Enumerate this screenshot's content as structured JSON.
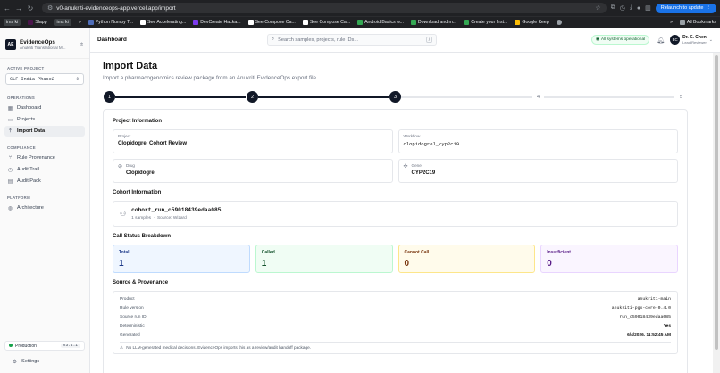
{
  "browser": {
    "url": "v0-anukriti-evidenceops-app.vercel.app/import",
    "relaunch_label": "Relaunch to update",
    "bookmarks": [
      "ims ki",
      "Slapp",
      "ims ki",
      "Python Numpy T...",
      "See Accelerating...",
      "DevCreate Hacka...",
      "See Compose Ca...",
      "See Compose Ca...",
      "Android Basics w...",
      "Download and m...",
      "Create your first...",
      "Google Keep"
    ],
    "all_bookmarks_label": "All Bookmarks"
  },
  "sidebar": {
    "brand_logo": "AE",
    "brand_name": "EvidenceOps",
    "brand_sub": "Anukriti Translational M...",
    "active_project_heading": "ACTIVE PROJECT",
    "active_project": "CLF-India-Phase2",
    "operations_heading": "OPERATIONS",
    "operations": [
      {
        "label": "Dashboard",
        "icon": "grid-icon"
      },
      {
        "label": "Projects",
        "icon": "folder-icon"
      },
      {
        "label": "Import Data",
        "icon": "upload-icon"
      }
    ],
    "compliance_heading": "COMPLIANCE",
    "compliance": [
      {
        "label": "Rule Provenance",
        "icon": "branch-icon"
      },
      {
        "label": "Audit Trail",
        "icon": "clock-icon"
      },
      {
        "label": "Audit Pack",
        "icon": "document-icon"
      }
    ],
    "platform_heading": "PLATFORM",
    "platform": [
      {
        "label": "Architecture",
        "icon": "globe-icon"
      }
    ],
    "environment": "Production",
    "version": "v3.4.1",
    "settings_label": "Settings"
  },
  "topbar": {
    "breadcrumb": "Dashboard",
    "search_placeholder": "Search samples, projects, rule IDs...",
    "search_shortcut": "/",
    "system_status": "All systems operational",
    "user_initials": "EC",
    "user_name": "Dr. E. Chen",
    "user_role": "Lead Reviewer"
  },
  "page": {
    "title": "Import Data",
    "subtitle": "Import a pharmacogenomics review package from an Anukriti EvidenceOps export file",
    "steps": [
      "1",
      "2",
      "3",
      "4",
      "5"
    ],
    "steps_completed": 3
  },
  "project_info": {
    "heading": "Project Information",
    "project_label": "Project",
    "project_value": "Clopidogrel Cohort Review",
    "workflow_label": "Workflow",
    "workflow_value": "clopidogrel_cyp2c19",
    "drug_label": "Drug",
    "drug_value": "Clopidogrel",
    "gene_label": "Gene",
    "gene_value": "CYP2C19"
  },
  "cohort_info": {
    "heading": "Cohort Information",
    "cohort_id": "cohort_run_c59018439edaa085",
    "samples": "1 samples",
    "source": "Source: Wizard"
  },
  "call_status": {
    "heading": "Call Status Breakdown",
    "items": [
      {
        "label": "Total",
        "value": "1"
      },
      {
        "label": "Called",
        "value": "1"
      },
      {
        "label": "Cannot Call",
        "value": "0"
      },
      {
        "label": "Insufficient",
        "value": "0"
      }
    ]
  },
  "provenance": {
    "heading": "Source & Provenance",
    "rows": [
      {
        "label": "Product",
        "value": "anukriti-main"
      },
      {
        "label": "Rule version",
        "value": "anukriti-pgx-core-0.4.0"
      },
      {
        "label": "Source run ID",
        "value": "run_c59018439edaa085"
      },
      {
        "label": "Deterministic",
        "value": "Yes"
      },
      {
        "label": "Generated",
        "value": "6/4/2026, 11:52:45 AM"
      }
    ],
    "note": "No LLM-generated medical decisions. EvidenceOps imports this as a review/audit handoff package."
  }
}
